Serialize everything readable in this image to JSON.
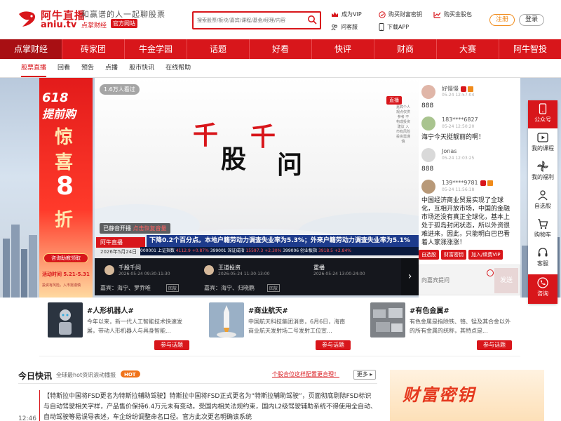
{
  "brand": {
    "name_cn": "阿牛直播",
    "name_en": "aniu.tv",
    "slogan": "和赢谱的人一起聊股票",
    "sub_brand": "点掌财经",
    "badge": "官方网站"
  },
  "search": {
    "placeholder": "搜索股票/板块/嘉宾/课程/基金/经理/内容"
  },
  "header_links": {
    "vip": "成为VIP",
    "key": "购买财富密钥",
    "gold": "购买金股包",
    "ask": "问客服",
    "app": "下载APP"
  },
  "auth": {
    "register": "注册",
    "login": "登录"
  },
  "main_nav": [
    "点掌财经",
    "砖家团",
    "牛金学园",
    "话题",
    "好看",
    "快评",
    "财商",
    "大赛",
    "阿牛智投"
  ],
  "sub_nav": [
    "股票直播",
    "回看",
    "预告",
    "点播",
    "股市快讯",
    "在线帮助"
  ],
  "promo": {
    "top": "618",
    "title": "提前购",
    "line1": "惊",
    "line2": "喜",
    "line3": "8",
    "line4": "折",
    "cta": "咨询助教领取",
    "period": "活动时间 5.21-5.31",
    "note": "投资有风险，入市需谨慎"
  },
  "video": {
    "viewers": "1.6万人看过",
    "title_chars": [
      "千",
      "股",
      "千",
      "问"
    ],
    "live_tag": "直播",
    "vert_text": "嘉宾个人观点仅供参考 不构成投资建议 入市有风险 投资需谨慎",
    "unmute": "已静音开播",
    "unmute_action": "点击恢复音量",
    "logo": "阿牛直播",
    "date": "2026年5月24日",
    "ticker": "下降0.2个百分点。本地户籍劳动力调查失业率为5.3%；外来户籍劳动力调查失业率为5.1%",
    "stocks": [
      {
        "code": "000001",
        "name": "上证指数",
        "value": "4112.9",
        "change": "+0.87%"
      },
      {
        "code": "399001",
        "name": "深证成指",
        "value": "15597.3",
        "change": "+2.30%"
      },
      {
        "code": "399006",
        "name": "创业板指",
        "value": "3918.5",
        "change": "+2.84%"
      }
    ]
  },
  "schedule": [
    {
      "title": "千股千问",
      "time": "2026-05-24 09:30-11:30",
      "guests": "嘉宾：海宁、罗乔唯",
      "tag": "回放"
    },
    {
      "title": "王道投资",
      "time": "2026-05-24 11:30-13:00",
      "guests": "嘉宾：海宁、归晓鹏",
      "tag": "回放"
    },
    {
      "title": "重播",
      "time": "2026-05-24 13:00-24:00",
      "guests": "",
      "tag": ""
    }
  ],
  "chat": {
    "messages": [
      {
        "name": "好慢慢",
        "date": "05-24 12:57:04",
        "text": "888"
      },
      {
        "name": "183****6827",
        "date": "05-24 12:50:20",
        "text": "海宁今天挺靓丽的啊！"
      },
      {
        "name": "Jonas",
        "date": "05-24 12:03:25",
        "text": "888"
      },
      {
        "name": "139****9781",
        "date": "05-24 11:56:18",
        "text": "中国经济商业贸易实现了全球化，互相开放市场，中国的金融市场还没有真正全球化，基本上处于孤岛封闭状态，所以外资很难进来，因此，只能明白巴巴看着人家涨涨涨！"
      }
    ],
    "buttons": [
      "自选股",
      "财富密钥",
      "加入/续费VIP"
    ],
    "input_placeholder": "向嘉宾提问",
    "send": "发送"
  },
  "right_bar": [
    "公众号",
    "我的课程",
    "我的福利",
    "自选股",
    "购物车",
    "客服",
    "咨询"
  ],
  "topics": [
    {
      "title": "#人形机器人#",
      "body": "今年以来，新一代人工智能技术快速发展，带动人形机器人与具身智能...",
      "button": "参与话题"
    },
    {
      "title": "#商业航天#",
      "body": "中国航天科技集团消息，6月6日，海南商业航天发射场二号发射工位宣...",
      "button": "参与话题"
    },
    {
      "title": "#有色金属#",
      "body": "有色金属是指除铁、铬、锰及其合金以外的所有金属的统称，其特点是...",
      "button": "参与话题"
    }
  ],
  "news": {
    "title": "今日快讯",
    "subtitle": "全球最hot资讯滚动播报",
    "notice": "个股合位这样配置更合理！",
    "more": "更多",
    "time": "12:46",
    "body": "【特斯拉中国将FSD更名为特斯拉辅助驾驶】特斯拉中国将FSD正式更名为“特斯拉辅助驾驶”，页面彻底剔除FSD标识与自动驾驶相关字样，产品售价保持6.4万元未有变动。受国内相关法规约束，国内L2级驾驶辅助系统不得使用全自动、自动驾驶等易误导表述，车企纷纷调整命名口径。官方此次更名明确该系统"
  },
  "wealth": {
    "text": "财富密钥"
  },
  "colors": {
    "brand_red": "#d8161b",
    "accent_orange": "#f08b1a"
  }
}
